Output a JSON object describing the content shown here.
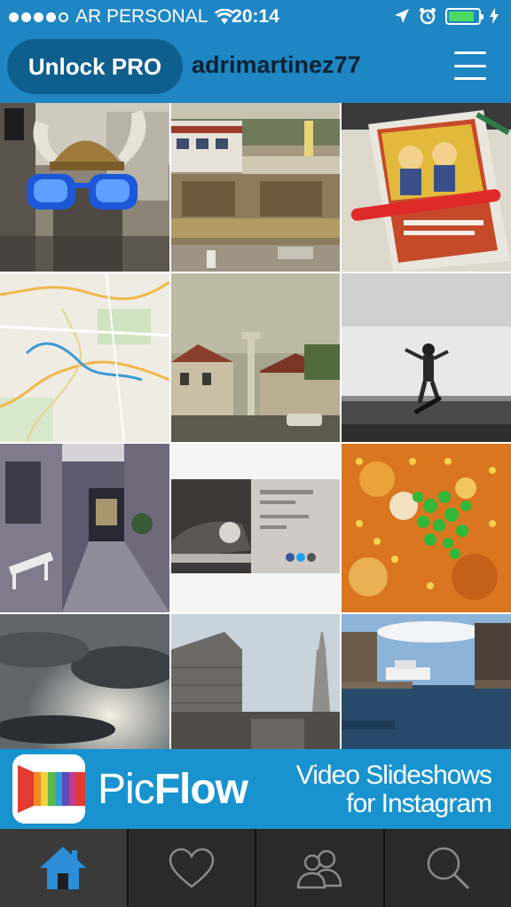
{
  "status_bar": {
    "carrier": "AR PERSONAL",
    "time": "20:14"
  },
  "header": {
    "unlock_label": "Unlock PRO",
    "username": "adrimartinez77",
    "accent_color": "#1f86c4"
  },
  "photos": [
    {
      "subject": "viking helmet figure with blue sunglasses"
    },
    {
      "subject": "canal locks with buildings"
    },
    {
      "subject": "mcdonalds book with red pen"
    },
    {
      "subject": "city street map"
    },
    {
      "subject": "village square with monument"
    },
    {
      "subject": "skateboarder mid-air black and white"
    },
    {
      "subject": "alley with bench and doorway"
    },
    {
      "subject": "vintage car business card"
    },
    {
      "subject": "corn stew with green onions"
    },
    {
      "subject": "cloudy sky with sun"
    },
    {
      "subject": "tall buildings from below"
    },
    {
      "subject": "harbor with boats and pier"
    }
  ],
  "banner": {
    "brand_pic": "Pic",
    "brand_flow": "Flow",
    "tagline_line1": "Video Slideshows",
    "tagline_line2": "for Instagram",
    "banner_color": "#1893cf"
  },
  "tabs": [
    {
      "name": "home",
      "icon": "home-icon",
      "active": true
    },
    {
      "name": "likes",
      "icon": "heart-icon",
      "active": false
    },
    {
      "name": "following",
      "icon": "people-icon",
      "active": false
    },
    {
      "name": "search",
      "icon": "search-icon",
      "active": false
    }
  ]
}
